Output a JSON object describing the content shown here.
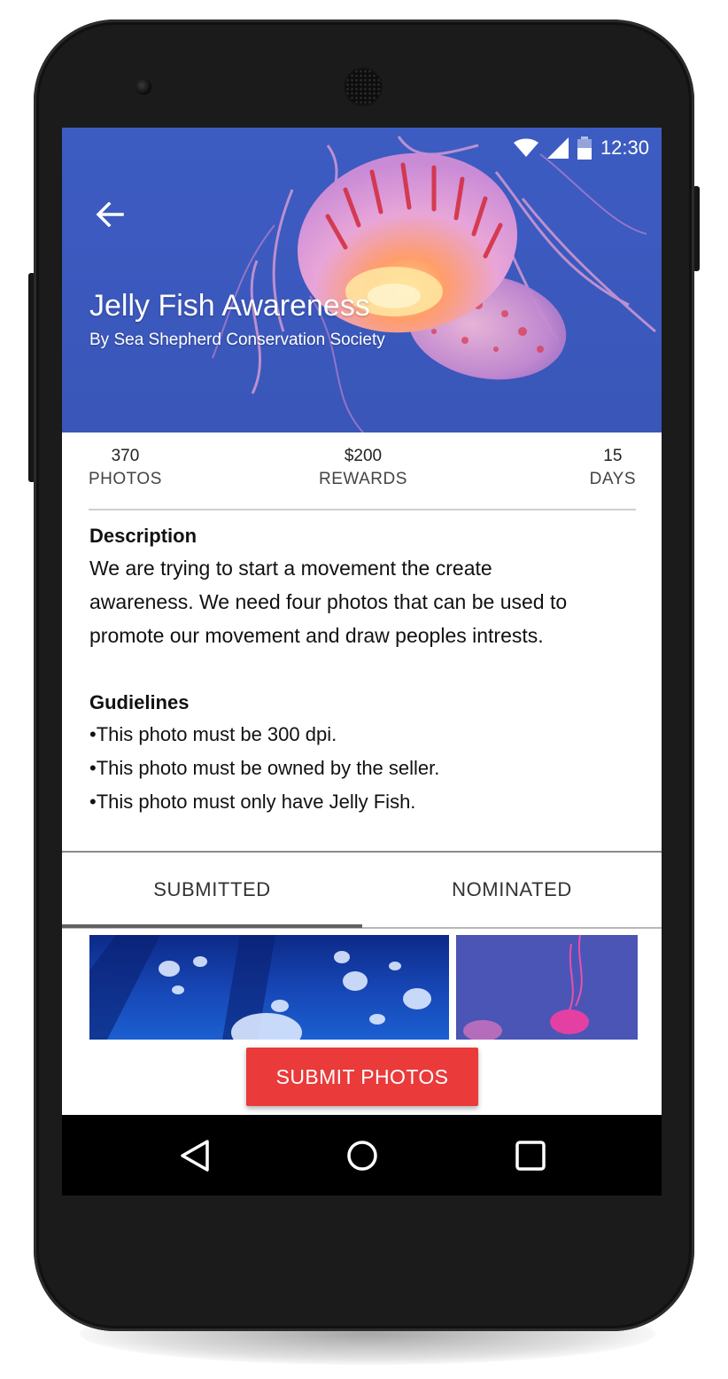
{
  "status_bar": {
    "time": "12:30"
  },
  "hero": {
    "title": "Jelly Fish Awareness",
    "subtitle": "By Sea Shepherd Conservation Society"
  },
  "stats": [
    {
      "value": "370",
      "label": "PHOTOS"
    },
    {
      "value": "$200",
      "label": "REWARDS"
    },
    {
      "value": "15",
      "label": "DAYS"
    }
  ],
  "description": {
    "title": "Description",
    "lines": [
      "We are trying to start a movement the create",
      "awareness. We need four photos that can be used to",
      "promote our movement and draw peoples intrests."
    ]
  },
  "guidelines": {
    "title": "Gudielines",
    "items": [
      "•This photo must be 300 dpi.",
      "•This photo must be owned by the seller.",
      "•This photo must only have Jelly Fish."
    ]
  },
  "tabs": [
    {
      "label": "SUBMITTED",
      "active": true
    },
    {
      "label": "NOMINATED",
      "active": false
    }
  ],
  "actions": {
    "submit_label": "SUBMIT PHOTOS"
  },
  "nav_icons": [
    "back-triangle-icon",
    "home-circle-icon",
    "recents-square-icon"
  ],
  "colors": {
    "hero_blue": "#3d5cc2",
    "accent_red": "#ea3a3a",
    "tab_indicator": "#616161"
  }
}
